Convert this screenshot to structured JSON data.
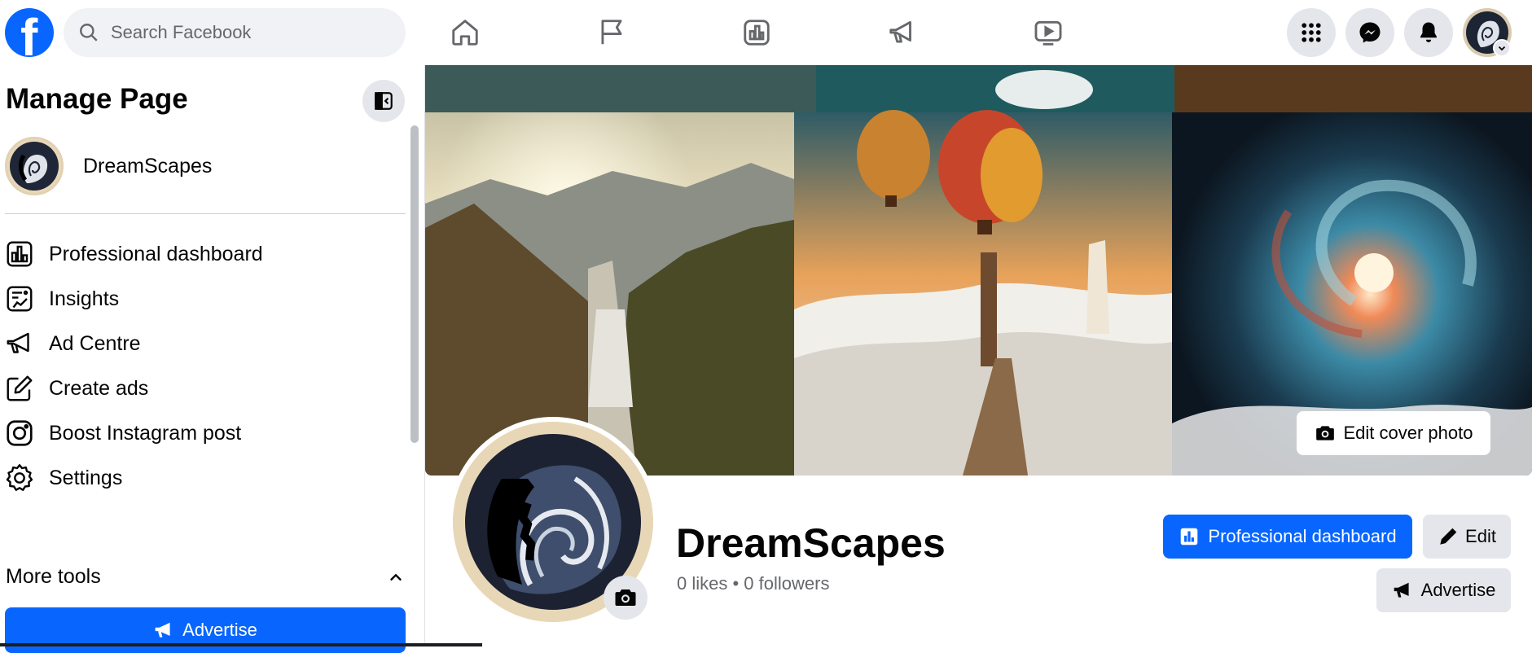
{
  "topbar": {
    "search_placeholder": "Search Facebook",
    "logo_letter": "f",
    "nav_icons": [
      "home-icon",
      "flag-icon",
      "dashboard-icon",
      "megaphone-icon",
      "video-icon"
    ],
    "right_icons": [
      "menu-grid-icon",
      "messenger-icon",
      "bell-icon"
    ]
  },
  "sidebar": {
    "title": "Manage Page",
    "page_name": "DreamScapes",
    "items": [
      {
        "label": "Professional dashboard",
        "icon": "dashboard-icon"
      },
      {
        "label": "Insights",
        "icon": "insights-icon"
      },
      {
        "label": "Ad Centre",
        "icon": "megaphone-icon"
      },
      {
        "label": "Create ads",
        "icon": "pencil-icon"
      },
      {
        "label": "Boost Instagram post",
        "icon": "instagram-icon"
      },
      {
        "label": "Settings",
        "icon": "gear-icon"
      }
    ],
    "more_tools": "More tools",
    "advertise": "Advertise"
  },
  "cover": {
    "edit_label": "Edit cover photo"
  },
  "profile": {
    "name": "DreamScapes",
    "stats": "0 likes • 0 followers",
    "btn_dashboard": "Professional dashboard",
    "btn_edit": "Edit",
    "btn_advertise": "Advertise"
  },
  "colors": {
    "brand": "#0866ff",
    "secondary_button": "#e4e6eb",
    "muted_text": "#65676b"
  }
}
